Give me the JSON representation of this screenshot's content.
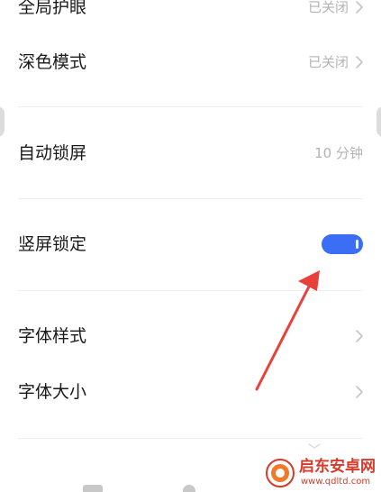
{
  "settings": {
    "items": [
      {
        "label": "全局护眼",
        "value": "已关闭",
        "chevron": true
      },
      {
        "label": "深色模式",
        "value": "已关闭",
        "chevron": true
      },
      {
        "label": "自动锁屏",
        "value": "10 分钟",
        "chevron": false
      },
      {
        "label": "竖屏锁定",
        "toggle_on": true
      },
      {
        "label": "字体样式",
        "chevron": true
      },
      {
        "label": "字体大小",
        "chevron": true
      }
    ]
  },
  "colors": {
    "toggle_on": "#3b6df5",
    "annotation_arrow": "#e8403a",
    "watermark": "#d63a2a"
  },
  "icons": {
    "chevron": "chevron-right-icon",
    "watermark_logo": "qdltd-logo-icon"
  },
  "watermark": {
    "title": "启东安卓网",
    "url": "www.qdltd.com"
  }
}
